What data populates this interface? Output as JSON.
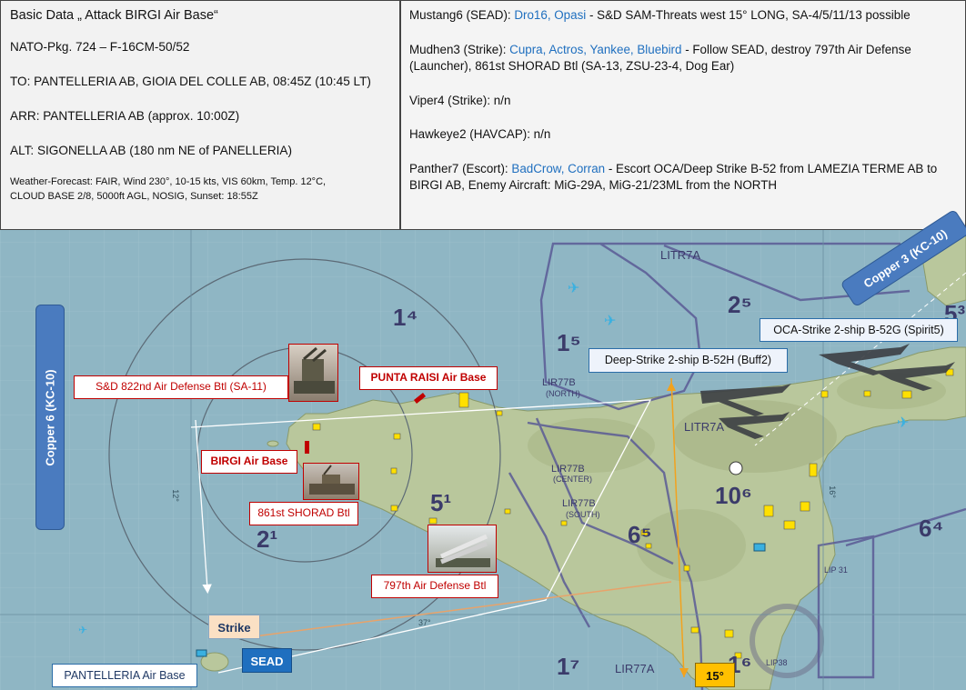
{
  "briefing": {
    "title": "Basic Data „ Attack BIRGI Air Base“",
    "package": "NATO-Pkg. 724 – F-16CM-50/52",
    "takeoff": "TO: PANTELLERIA AB, GIOIA DEL COLLE AB, 08:45Z (10:45 LT)",
    "arrival": "ARR: PANTELLERIA AB (approx. 10:00Z)",
    "alternate": "ALT: SIGONELLA AB (180 nm NE of PANELLERIA)",
    "weather_line1": "Weather-Forecast: FAIR, Wind 230°, 10-15 kts, VIS 60km, Temp. 12°C,",
    "weather_line2": "CLOUD BASE 2/8, 5000ft AGL, NOSIG, Sunset: 18:55Z"
  },
  "flights": [
    {
      "callsign": "Mustang6 (SEAD): ",
      "pilots": "Dro16, Opasi",
      "task": " - S&D SAM-Threats west 15° LONG, SA-4/5/11/13 possible"
    },
    {
      "callsign": "Mudhen3 (Strike): ",
      "pilots": "Cupra, Actros, Yankee, Bluebird",
      "task": " - Follow SEAD, destroy 797th Air Defense (Launcher), 861st SHORAD Btl (SA-13, ZSU-23-4, Dog Ear)"
    },
    {
      "callsign": "Viper4 (Strike): n/n",
      "pilots": "",
      "task": ""
    },
    {
      "callsign": "Hawkeye2 (HAVCAP): n/n",
      "pilots": "",
      "task": ""
    },
    {
      "callsign": "Panther7 (Escort): ",
      "pilots": "BadCrow, Corran",
      "task": " - Escort OCA/Deep Strike B-52 from LAMEZIA TERME AB to BIRGI AB, Enemy Aircraft: MiG-29A, MiG-21/23ML from the NORTH"
    }
  ],
  "map_labels": {
    "sd_822": "S&D 822nd Air Defense Btl (SA-11)",
    "punta_raisi": "PUNTA RAISI Air Base",
    "birgi": "BIRGI Air Base",
    "shorad_861": "861st SHORAD Btl",
    "ad_797": "797th Air Defense Btl",
    "pantelleria": "PANTELLERIA Air Base",
    "strike": "Strike",
    "sead": "SEAD",
    "longitude": "15°",
    "deep_strike": "Deep-Strike 2-ship B-52H (Buff2)",
    "oca_strike": "OCA-Strike 2-ship B-52G (Spirit5)",
    "copper6": "Copper 6 (KC-10)",
    "copper3": "Copper 3 (KC-10)",
    "litr7a_n": "LITR7A",
    "lir77b_n1": "LIR77B",
    "lir77b_n2": "(NORTH)",
    "litr7a_c": "LITR7A",
    "lir77b_c1": "LIR77B",
    "lir77b_c2": "(CENTER)",
    "lir77b_s1": "LIR77B",
    "lir77b_s2": "(SOUTH)",
    "lir77a": "LIR77A",
    "lip31": "LIP 31",
    "lip38": "LIP38",
    "grid_14": "1⁴",
    "grid_15": "1⁵",
    "grid_25": "2⁵",
    "grid_21": "2¹",
    "grid_51": "5¹",
    "grid_65": "6⁵",
    "grid_106": "10⁶",
    "grid_64": "6⁴",
    "grid_17": "1⁷",
    "grid_16": "1⁶",
    "grid_53": "5³",
    "meridian_12": "12°",
    "meridian_16": "16°",
    "parallel_37": "37°"
  },
  "colors": {
    "sea": "#8fb6c4",
    "land": "#b9c79c",
    "airspace": "#5b5b96",
    "tag_red": "#c00000",
    "blue_bar": "#4a7bbf",
    "orange_tag": "#fbe0c4",
    "sead_tag": "#1f6fbf",
    "yellow_tag": "#ffc000"
  }
}
